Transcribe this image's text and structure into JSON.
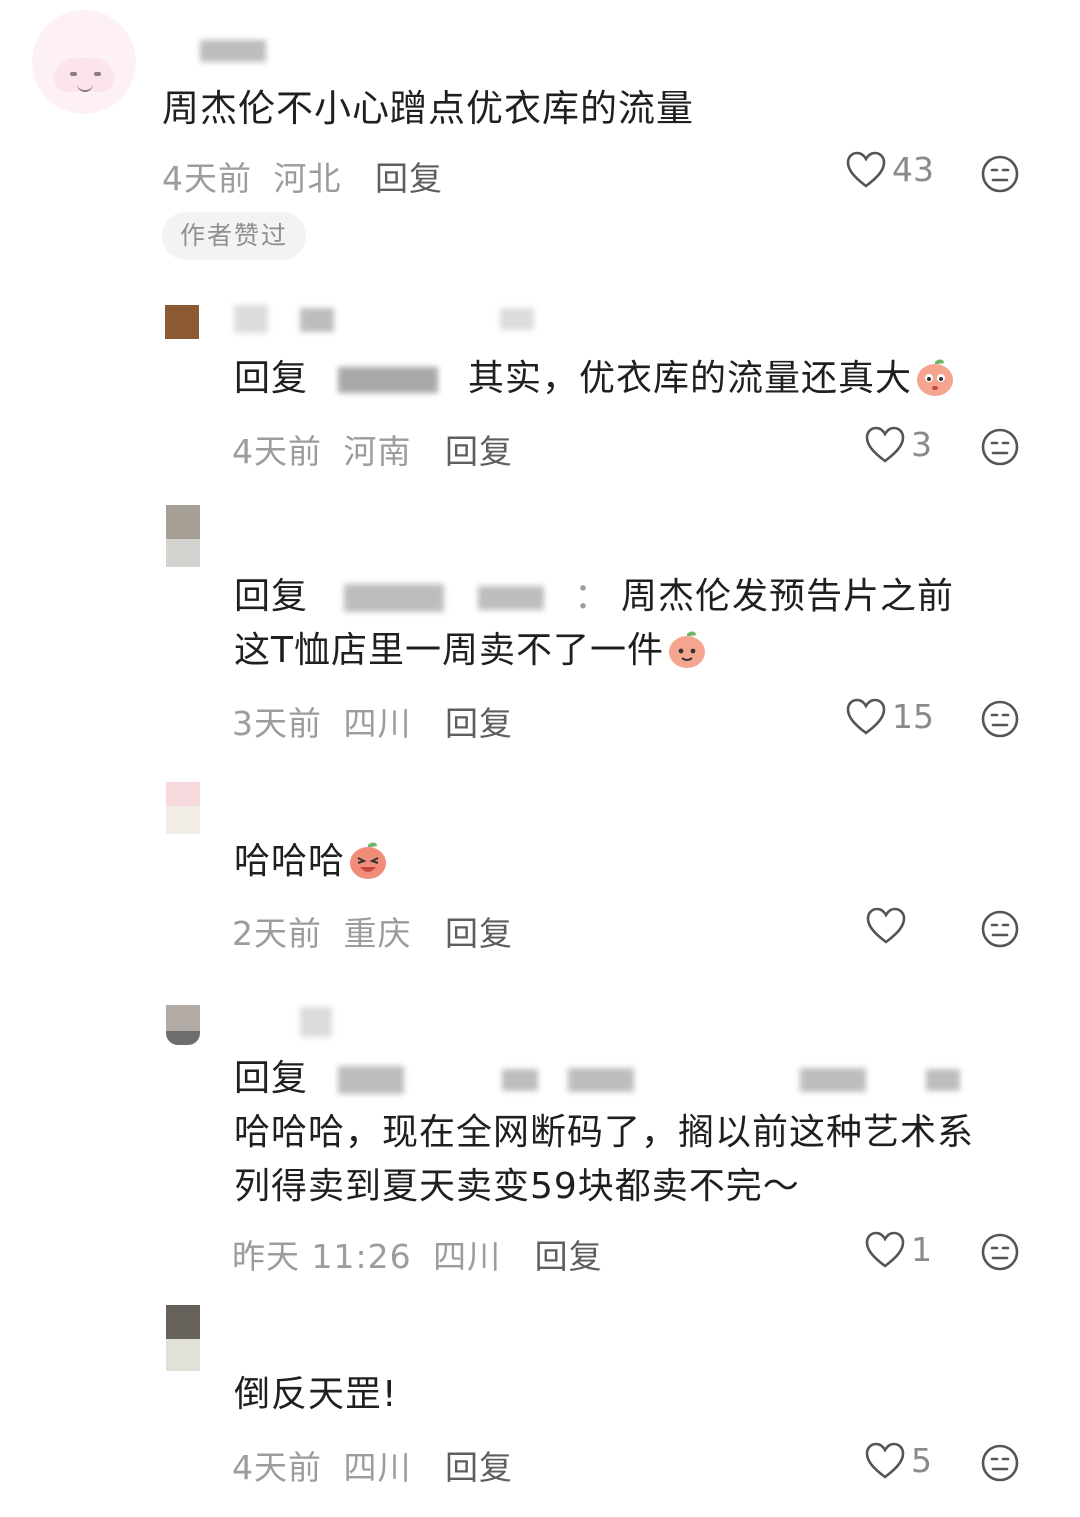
{
  "labels": {
    "reply": "回复",
    "reply_prefix": "回复"
  },
  "comments": [
    {
      "text": "周杰伦不小心蹭点优衣库的流量",
      "time": "4天前",
      "location": "河北",
      "likes": "43",
      "badge": "作者赞过"
    },
    {
      "text": "其实，优衣库的流量还真大",
      "time": "4天前",
      "location": "河南",
      "likes": "3"
    },
    {
      "text_line1": "周杰伦发预告片之前",
      "text_line2": "这T恤店里一周卖不了一件",
      "time": "3天前",
      "location": "四川",
      "likes": "15"
    },
    {
      "text": "哈哈哈",
      "time": "2天前",
      "location": "重庆",
      "likes": ""
    },
    {
      "text_line1": "哈哈哈，现在全网断码了，搁以前这种艺术系",
      "text_line2": "列得卖到夏天卖变59块都卖不完～",
      "time": "昨天 11:26",
      "location": "四川",
      "likes": "1"
    },
    {
      "text": "倒反天罡!",
      "time": "4天前",
      "location": "四川",
      "likes": "5"
    }
  ],
  "icons": {
    "like": "heart-outline-icon",
    "dislike": "neutral-face-icon",
    "emoji": "peach-emoji-icon"
  },
  "colors": {
    "text": "#1f1f1f",
    "meta": "#9c9c9c",
    "badge_bg": "#f3f3f3"
  }
}
